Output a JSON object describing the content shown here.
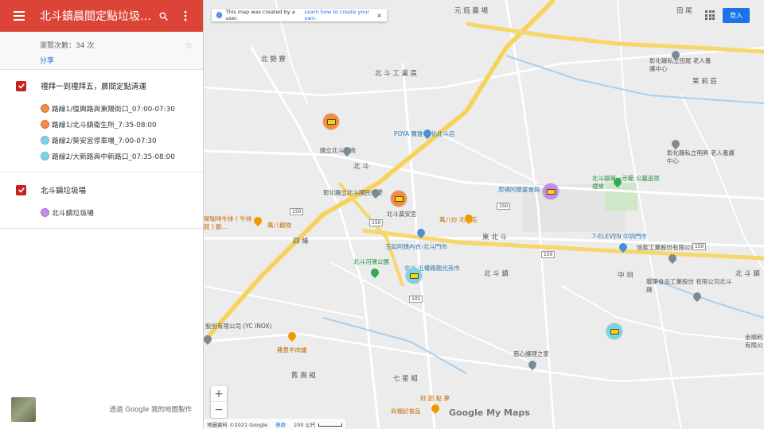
{
  "header": {
    "title": "北斗鎮晨間定點垃圾、...",
    "menu_icon": "menu-icon",
    "search_icon": "search-icon",
    "more_icon": "more-vert-icon"
  },
  "meta": {
    "views": "瀏覽次數：34 次",
    "share": "分享"
  },
  "layers": [
    {
      "title": "禮拜一到禮拜五，晨間定點清運",
      "items": [
        {
          "label": "路線1/復興路與東陽街口_07:00-07:30",
          "color": "#f28b44"
        },
        {
          "label": "路線1/北斗鎮衛生所_7:35-08:00",
          "color": "#f28b44"
        },
        {
          "label": "路線2/葵安宮停車場_7:00-07:30",
          "color": "#7cd3e8"
        },
        {
          "label": "路線2/大新路與中新路口_07:35-08:00",
          "color": "#7cd3e8"
        }
      ]
    },
    {
      "title": "北斗鎮垃圾場",
      "items": [
        {
          "label": "北斗鎮垃圾場",
          "color": "#c58af0"
        }
      ]
    }
  ],
  "footer": {
    "text": "透過 Google 我的地圖製作"
  },
  "map": {
    "notice_text": "This map was created by a user.",
    "notice_link": "Learn how to create your own.",
    "notice_close": "×",
    "signin": "登入",
    "zoom_in": "+",
    "zoom_out": "−",
    "logo_google": "Google",
    "logo_suffix": " My Maps",
    "attribution": "地圖資料 ©2021 Google",
    "terms": "條款",
    "scale": "200 公尺",
    "labels": {
      "beidou_county": "北 勢 寮",
      "industrial": "北 斗 工 業 區",
      "poya": "POYA 寶雅 彰化北斗店",
      "beidou_home": "國立北斗家商",
      "beidou": "北 斗",
      "school": "彰化縣立北斗國民中學",
      "kuian": "北斗奠安宮",
      "wanba": "萬八炒 北斗店",
      "wanba_duck": "萬八鵝物",
      "yuru": "玉如阿姨內衣-北斗門市",
      "river_park": "北斗河濱公園",
      "market": "北斗 五權路觀光夜市",
      "east_beidou": "東 北 斗",
      "beidou_town": "北 斗 鎮",
      "sijing": "四 維",
      "seven": "7-ELEVEN 中圳門市",
      "xinkuang": "信鋐工業股份有限公司",
      "lianhua": "聯華食品工業股份 有限公司北斗廠",
      "yc": "股份有限公司 (YC INOX)",
      "jiuyi": "雞意羊肉爐",
      "jiuxin": "慈心護理之家",
      "jiusheng": "尚福記食品",
      "qixing": "七 星 組",
      "jiushu": "舊 眉 組",
      "yufu": "原福阿嬤宴會館",
      "grave": "北斗鎮第一示範 公墓追思禮堂",
      "nursing": "彰化縣私立田尾 老人養護中心",
      "nursing2": "彰化縣私立明昇 老人養護中心",
      "cafe": "彎咖啡牛排 ( 牛排館 ) 斷...",
      "zhongzhu": "中 圳",
      "yuanzhu": "元 鈺 農 場",
      "tianfu": "田 尾",
      "zhuangzi": "好 甜 點 夢",
      "beidou_east": "北 斗 鎮",
      "molizhuang": "茉 莉 莊",
      "jinlin": "金順利 有限公"
    }
  }
}
